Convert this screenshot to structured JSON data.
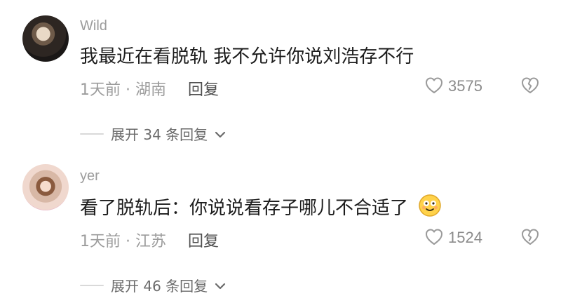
{
  "comments": [
    {
      "username": "Wild",
      "text": "我最近在看脱轨 我不允许你说刘浩存不行",
      "meta": "1天前 · 湖南",
      "reply_label": "回复",
      "likes": "3575",
      "expand_label": "展开 34 条回复",
      "avatar_icon": "user-avatar-1"
    },
    {
      "username": "yer",
      "text": "看了脱轨后：你说说看存子哪儿不合适了",
      "meta": "1天前 · 江苏",
      "reply_label": "回复",
      "likes": "1524",
      "expand_label": "展开 46 条回复",
      "avatar_icon": "user-avatar-2",
      "emoji_icon": "smiling-face-icon"
    }
  ],
  "icons": {
    "like": "heart-outline-icon",
    "dislike": "broken-heart-icon",
    "expand": "chevron-down-icon"
  },
  "colors": {
    "text_primary": "#1c1c1c",
    "text_secondary": "#9c9c9c",
    "reply": "#4f4f4f"
  }
}
